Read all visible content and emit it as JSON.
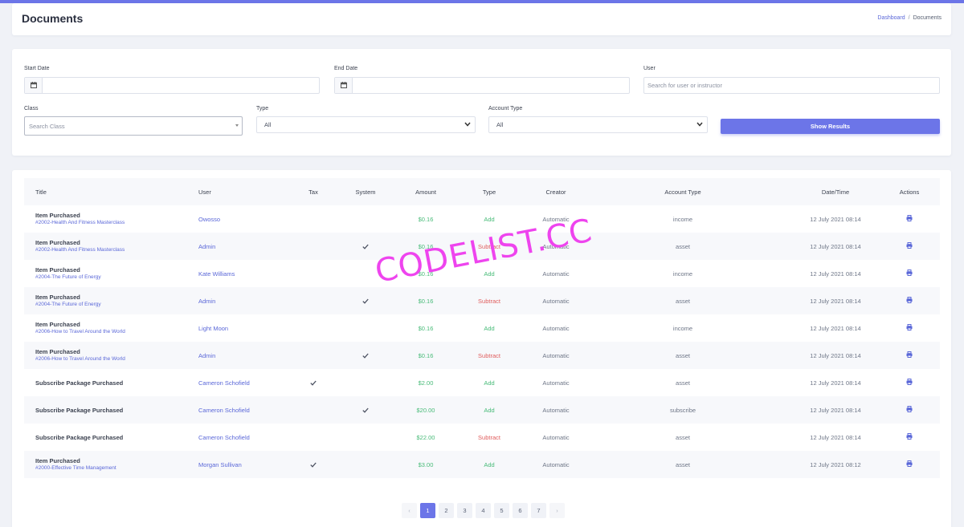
{
  "header": {
    "title": "Documents",
    "breadcrumb": [
      "Dashboard",
      "Documents"
    ]
  },
  "filters": {
    "start_date": {
      "label": "Start Date",
      "value": ""
    },
    "end_date": {
      "label": "End Date",
      "value": ""
    },
    "user": {
      "label": "User",
      "placeholder": "Search for user or instructor"
    },
    "class": {
      "label": "Class",
      "placeholder": "Search Class"
    },
    "type": {
      "label": "Type",
      "value": "All"
    },
    "account_type": {
      "label": "Account Type",
      "value": "All"
    },
    "submit_label": "Show Results"
  },
  "table": {
    "columns": [
      "Title",
      "User",
      "Tax",
      "System",
      "Amount",
      "Type",
      "Creator",
      "Account Type",
      "Date/Time",
      "Actions"
    ],
    "rows": [
      {
        "title": "Item Purchased",
        "subtitle": "#2002-Health And Fitness Masterclass",
        "user": "Owosso",
        "tax": false,
        "system": false,
        "amount": "$0.16",
        "type": "Add",
        "creator": "Automatic",
        "account_type": "income",
        "datetime": "12 July 2021 08:14"
      },
      {
        "title": "Item Purchased",
        "subtitle": "#2002-Health And Fitness Masterclass",
        "user": "Admin",
        "tax": false,
        "system": true,
        "amount": "$0.16",
        "type": "Subtract",
        "creator": "Automatic",
        "account_type": "asset",
        "datetime": "12 July 2021 08:14"
      },
      {
        "title": "Item Purchased",
        "subtitle": "#2004-The Future of Energy",
        "user": "Kate Williams",
        "tax": false,
        "system": false,
        "amount": "$0.16",
        "type": "Add",
        "creator": "Automatic",
        "account_type": "income",
        "datetime": "12 July 2021 08:14"
      },
      {
        "title": "Item Purchased",
        "subtitle": "#2004-The Future of Energy",
        "user": "Admin",
        "tax": false,
        "system": true,
        "amount": "$0.16",
        "type": "Subtract",
        "creator": "Automatic",
        "account_type": "asset",
        "datetime": "12 July 2021 08:14"
      },
      {
        "title": "Item Purchased",
        "subtitle": "#2006-How to Travel Around the World",
        "user": "Light Moon",
        "tax": false,
        "system": false,
        "amount": "$0.16",
        "type": "Add",
        "creator": "Automatic",
        "account_type": "income",
        "datetime": "12 July 2021 08:14"
      },
      {
        "title": "Item Purchased",
        "subtitle": "#2006-How to Travel Around the World",
        "user": "Admin",
        "tax": false,
        "system": true,
        "amount": "$0.16",
        "type": "Subtract",
        "creator": "Automatic",
        "account_type": "asset",
        "datetime": "12 July 2021 08:14"
      },
      {
        "title": "Subscribe Package Purchased",
        "subtitle": "",
        "user": "Cameron Schofield",
        "tax": true,
        "system": false,
        "amount": "$2.00",
        "type": "Add",
        "creator": "Automatic",
        "account_type": "asset",
        "datetime": "12 July 2021 08:14"
      },
      {
        "title": "Subscribe Package Purchased",
        "subtitle": "",
        "user": "Cameron Schofield",
        "tax": false,
        "system": true,
        "amount": "$20.00",
        "type": "Add",
        "creator": "Automatic",
        "account_type": "subscribe",
        "datetime": "12 July 2021 08:14"
      },
      {
        "title": "Subscribe Package Purchased",
        "subtitle": "",
        "user": "Cameron Schofield",
        "tax": false,
        "system": false,
        "amount": "$22.00",
        "type": "Subtract",
        "creator": "Automatic",
        "account_type": "asset",
        "datetime": "12 July 2021 08:14"
      },
      {
        "title": "Item Purchased",
        "subtitle": "#2000-Effective Time Management",
        "user": "Morgan Sullivan",
        "tax": true,
        "system": false,
        "amount": "$3.00",
        "type": "Add",
        "creator": "Automatic",
        "account_type": "asset",
        "datetime": "12 July 2021 08:12"
      }
    ]
  },
  "pagination": {
    "prev": "‹",
    "next": "›",
    "pages": [
      "1",
      "2",
      "3",
      "4",
      "5",
      "6",
      "7"
    ],
    "active": "1"
  },
  "watermark": "CODELIST.CC",
  "icons": {
    "calendar": "calendar-icon",
    "check": "check-icon",
    "print": "print-icon",
    "chevron": "chevron-down-icon"
  },
  "colors": {
    "primary": "#6c75e8",
    "link": "#5a67d8",
    "add": "#48bb78",
    "subtract": "#e05c5c",
    "watermark": "#ee44ee"
  }
}
